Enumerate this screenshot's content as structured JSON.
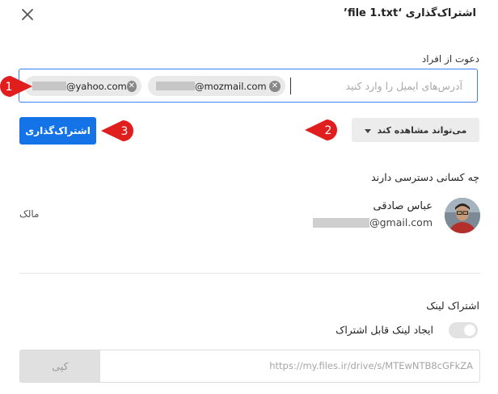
{
  "dialog": {
    "title": "اشتراک‌گذاری ‘file 1.txt’",
    "close_icon": "close-icon"
  },
  "invite": {
    "label": "دعوت از افراد",
    "placeholder": "آدرس‌های ایمیل را وارد کنید",
    "chips": [
      {
        "email_suffix": "@mozmail.com",
        "remove_icon": "remove-circle-icon"
      },
      {
        "email_suffix": "@yahoo.com",
        "remove_icon": "remove-circle-icon"
      }
    ]
  },
  "permission": {
    "selected": "می‌تواند مشاهده کند",
    "icon": "caret-down-icon"
  },
  "share_button": {
    "label": "اشتراک‌گذاری"
  },
  "markers": [
    {
      "number": "1",
      "color": "#e01e1e"
    },
    {
      "number": "2",
      "color": "#e01e1e"
    },
    {
      "number": "3",
      "color": "#e01e1e"
    }
  ],
  "access": {
    "label": "چه کسانی دسترسی دارند",
    "owner": {
      "name": "عباس صادقی",
      "email_suffix": "@gmail.com",
      "role": "مالک"
    }
  },
  "link_sharing": {
    "label": "اشتراک لینک",
    "toggle_label": "ایجاد لینک قابل اشتراک",
    "toggle_on": false,
    "url": "https://my.files.ir/drive/s/MTEwNTB8cGFkZA",
    "copy_label": "کپی"
  },
  "colors": {
    "primary": "#1473e6",
    "marker": "#e01e1e",
    "focus_border": "#3b82f6"
  }
}
